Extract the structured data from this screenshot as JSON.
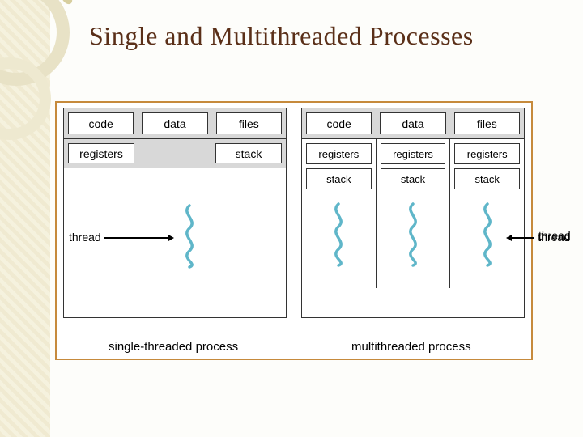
{
  "title": "Single and Multithreaded Processes",
  "single": {
    "shared": [
      "code",
      "data",
      "files"
    ],
    "perthread": {
      "registers": "registers",
      "stack": "stack"
    },
    "caption": "single-threaded process",
    "thread_label": "thread"
  },
  "multi": {
    "shared": [
      "code",
      "data",
      "files"
    ],
    "perthread": {
      "registers": "registers",
      "stack": "stack"
    },
    "caption": "multithreaded process",
    "thread_label": "thread",
    "thread_count": 3
  },
  "colors": {
    "accent": "#5fb6c9",
    "border": "#c68a3c"
  }
}
